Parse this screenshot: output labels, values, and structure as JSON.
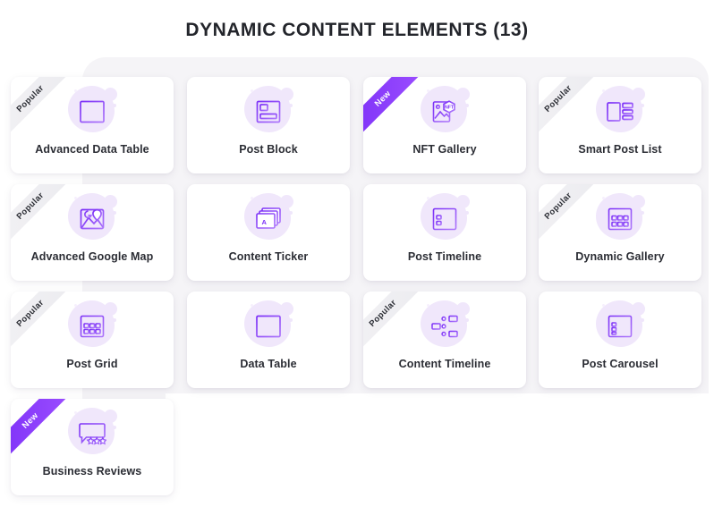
{
  "header": {
    "title": "DYNAMIC CONTENT ELEMENTS (13)"
  },
  "theme": {
    "page_background": "#ffffff",
    "panel_background": "#f5f4f7",
    "card_background": "#ffffff",
    "label_color": "#2b2d34",
    "icon_blob_color": "#f0e7fb",
    "icon_stroke_start": "#7b2ff7",
    "icon_stroke_end": "#a96dfb",
    "ribbon_new_gradient_start": "#7b2ff7",
    "ribbon_new_gradient_end": "#9b4dff",
    "ribbon_popular_background": "#f0eff3"
  },
  "badges": {
    "popular": "Popular",
    "new": "New"
  },
  "cards": [
    {
      "label": "Advanced Data Table",
      "badge": "Popular",
      "icon": "data-table-icon"
    },
    {
      "label": "Post Block",
      "badge": "",
      "icon": "post-block-icon"
    },
    {
      "label": "NFT Gallery",
      "badge": "New",
      "icon": "nft-gallery-icon"
    },
    {
      "label": "Smart Post List",
      "badge": "Popular",
      "icon": "smart-post-list-icon"
    },
    {
      "label": "Advanced Google Map",
      "badge": "Popular",
      "icon": "google-map-icon"
    },
    {
      "label": "Content Ticker",
      "badge": "",
      "icon": "content-ticker-icon"
    },
    {
      "label": "Post Timeline",
      "badge": "",
      "icon": "post-timeline-icon"
    },
    {
      "label": "Dynamic Gallery",
      "badge": "Popular",
      "icon": "dynamic-gallery-icon"
    },
    {
      "label": "Post Grid",
      "badge": "Popular",
      "icon": "post-grid-icon"
    },
    {
      "label": "Data Table",
      "badge": "",
      "icon": "data-table-plain-icon"
    },
    {
      "label": "Content Timeline",
      "badge": "Popular",
      "icon": "content-timeline-icon"
    },
    {
      "label": "Post Carousel",
      "badge": "",
      "icon": "post-carousel-icon"
    },
    {
      "label": "Business Reviews",
      "badge": "New",
      "icon": "business-reviews-icon"
    }
  ]
}
